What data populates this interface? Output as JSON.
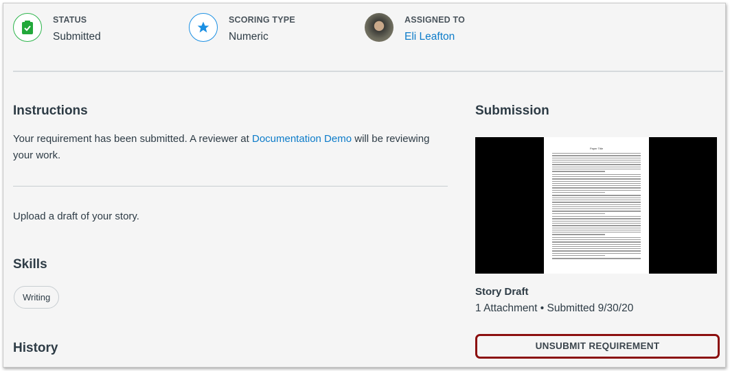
{
  "meta": {
    "status_label": "STATUS",
    "status_value": "Submitted",
    "scoring_label": "SCORING TYPE",
    "scoring_value": "Numeric",
    "assigned_label": "ASSIGNED TO",
    "assigned_value": "Eli Leafton"
  },
  "instructions": {
    "heading": "Instructions",
    "text_before": "Your requirement has been submitted. A reviewer at ",
    "link": "Documentation Demo",
    "text_after": " will be reviewing your work.",
    "description": "Upload a draft of your story."
  },
  "skills": {
    "heading": "Skills",
    "items": [
      "Writing"
    ]
  },
  "history": {
    "heading": "History"
  },
  "submission": {
    "heading": "Submission",
    "paper_title": "Paper Title",
    "title": "Story Draft",
    "details": "1 Attachment • Submitted 9/30/20",
    "unsubmit_label": "UNSUBMIT REQUIREMENT"
  },
  "colors": {
    "green": "#2bb44a",
    "blue": "#1a8fe3",
    "link": "#0b7bc9",
    "button_border": "#8b0e0e"
  }
}
